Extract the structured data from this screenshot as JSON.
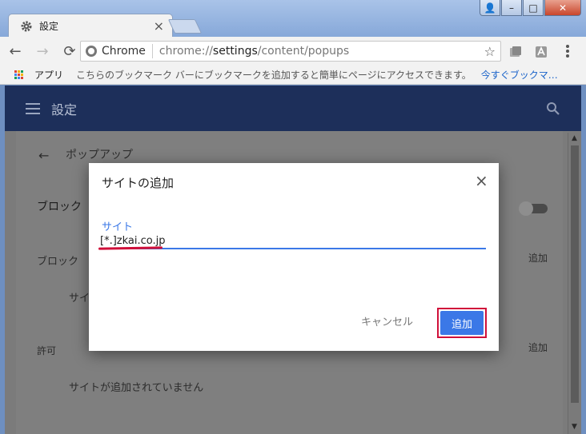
{
  "window": {
    "tab_title": "設定",
    "tab_close": "×",
    "controls": {
      "user": "👤",
      "minimize": "–",
      "maximize": "□",
      "close": "✕"
    }
  },
  "toolbar": {
    "back": "←",
    "forward": "→",
    "reload": "⟳",
    "chip_label": "Chrome",
    "url_prefix": "chrome://",
    "url_host": "settings",
    "url_path": "/content/popups",
    "star": "☆"
  },
  "bookmarks": {
    "apps_label": "アプリ",
    "hint": "こちらのブックマーク バーにブックマークを追加すると簡単にページにアクセスできます。",
    "import_link": "今すぐブックマ…"
  },
  "settings": {
    "app_title": "設定",
    "back_arrow": "←",
    "page_title": "ポップアップ",
    "block_toggle_label": "ブロック（",
    "block_section": "ブロック",
    "add_block": "追加",
    "block_empty": "サイ",
    "allow_section": "許可",
    "add_allow": "追加",
    "allow_empty": "サイトが追加されていません"
  },
  "dialog": {
    "title": "サイトの追加",
    "close": "×",
    "field_label": "サイト",
    "field_value": "[*.]zkai.co.jp",
    "cancel": "キャンセル",
    "add": "追加"
  },
  "colors": {
    "accent": "#3b78e7",
    "highlight": "#d0103a",
    "appbar": "#1d2f5a"
  }
}
